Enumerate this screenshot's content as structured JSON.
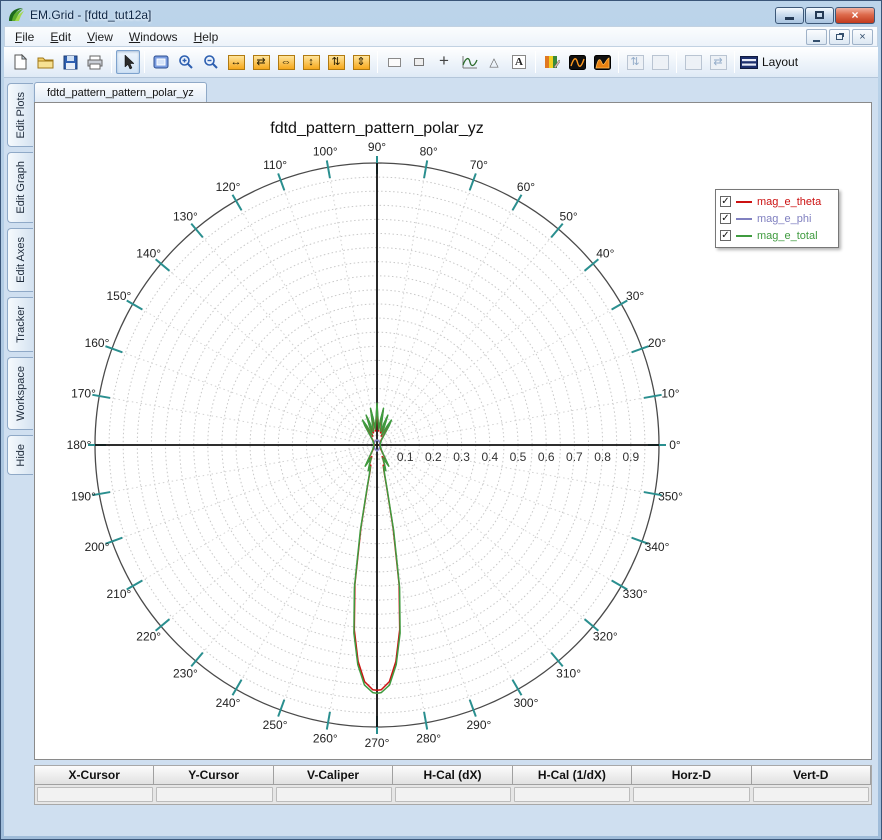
{
  "window": {
    "title": "EM.Grid - [fdtd_tut12a]"
  },
  "menu": {
    "items": [
      {
        "label": "File"
      },
      {
        "label": "Edit"
      },
      {
        "label": "View"
      },
      {
        "label": "Windows"
      },
      {
        "label": "Help"
      }
    ]
  },
  "toolbar": {
    "groups": [
      {
        "items": [
          {
            "icon": "new-document"
          },
          {
            "icon": "open-folder"
          },
          {
            "icon": "save"
          },
          {
            "icon": "print"
          }
        ]
      },
      {
        "items": [
          {
            "icon": "select-cursor",
            "pressed": true
          }
        ]
      },
      {
        "items": [
          {
            "icon": "zoom-region"
          },
          {
            "icon": "zoom-in"
          },
          {
            "icon": "zoom-out"
          },
          {
            "icon": "expand-horizontal"
          },
          {
            "icon": "pan-horizontal"
          },
          {
            "icon": "shrink-horizontal"
          },
          {
            "icon": "expand-vertical"
          },
          {
            "icon": "pan-vertical"
          },
          {
            "icon": "shrink-vertical"
          }
        ]
      },
      {
        "items": [
          {
            "icon": "draw-rectangle"
          },
          {
            "icon": "draw-box"
          },
          {
            "icon": "crosshair"
          },
          {
            "icon": "trace-curve"
          },
          {
            "icon": "draw-triangle"
          },
          {
            "icon": "text-annotation"
          }
        ]
      },
      {
        "items": [
          {
            "icon": "colormap-edit"
          },
          {
            "icon": "waveform-dark"
          },
          {
            "icon": "waveform-filled"
          }
        ]
      },
      {
        "items": [
          {
            "icon": "fit-vertical",
            "disabled": true
          },
          {
            "icon": "blank-tile",
            "disabled": true
          }
        ]
      },
      {
        "items": [
          {
            "icon": "blank-tile-2",
            "disabled": true
          },
          {
            "icon": "fit-horizontal",
            "disabled": true
          }
        ]
      },
      {
        "items": [
          {
            "icon": "layout-panels",
            "label": "Layout"
          }
        ]
      }
    ]
  },
  "sidebar": {
    "tabs": [
      "Edit Plots",
      "Edit Graph",
      "Edit Axes",
      "Tracker",
      "Workspace",
      "Hide"
    ]
  },
  "document_tab": "fdtd_pattern_pattern_polar_yz",
  "legend": {
    "items": [
      {
        "label": "mag_e_theta",
        "color": "#cc1111",
        "checked": true
      },
      {
        "label": "mag_e_phi",
        "color": "#8080c0",
        "checked": true
      },
      {
        "label": "mag_e_total",
        "color": "#3f9b3f",
        "checked": true
      }
    ]
  },
  "chart_data": {
    "type": "line",
    "subtype": "polar",
    "title": "fdtd_pattern_pattern_polar_yz",
    "angle_ticks_deg": [
      0,
      10,
      20,
      30,
      40,
      50,
      60,
      70,
      80,
      90,
      100,
      110,
      120,
      130,
      140,
      150,
      160,
      170,
      180,
      190,
      200,
      210,
      220,
      230,
      240,
      250,
      260,
      270,
      280,
      290,
      300,
      310,
      320,
      330,
      340,
      350
    ],
    "angle_tick_suffix": "°",
    "radius_ticks": [
      0.1,
      0.2,
      0.3,
      0.4,
      0.5,
      0.6,
      0.7,
      0.8,
      0.9
    ],
    "rlim": [
      0,
      1
    ],
    "rings": 20,
    "spoke_step_deg": 10,
    "grid": true,
    "legend_position": "top-right",
    "series": [
      {
        "name": "mag_e_theta",
        "color": "#cc1111",
        "points": [
          [
            0,
            0.01
          ],
          [
            15,
            0.01
          ],
          [
            30,
            0.012
          ],
          [
            40,
            0.015
          ],
          [
            48,
            0.02
          ],
          [
            54,
            0.035
          ],
          [
            58,
            0.075
          ],
          [
            60,
            0.095
          ],
          [
            62,
            0.07
          ],
          [
            64,
            0.035
          ],
          [
            67,
            0.05
          ],
          [
            70,
            0.105
          ],
          [
            72,
            0.075
          ],
          [
            74,
            0.045
          ],
          [
            77,
            0.06
          ],
          [
            80,
            0.125
          ],
          [
            82,
            0.085
          ],
          [
            84,
            0.05
          ],
          [
            87,
            0.075
          ],
          [
            90,
            0.14
          ],
          [
            93,
            0.075
          ],
          [
            96,
            0.05
          ],
          [
            98,
            0.085
          ],
          [
            100,
            0.125
          ],
          [
            103,
            0.06
          ],
          [
            106,
            0.045
          ],
          [
            108,
            0.075
          ],
          [
            110,
            0.105
          ],
          [
            113,
            0.05
          ],
          [
            116,
            0.035
          ],
          [
            118,
            0.07
          ],
          [
            120,
            0.095
          ],
          [
            122,
            0.075
          ],
          [
            126,
            0.035
          ],
          [
            132,
            0.02
          ],
          [
            140,
            0.015
          ],
          [
            150,
            0.012
          ],
          [
            165,
            0.01
          ],
          [
            180,
            0.01
          ],
          [
            195,
            0.01
          ],
          [
            210,
            0.012
          ],
          [
            220,
            0.015
          ],
          [
            228,
            0.02
          ],
          [
            234,
            0.03
          ],
          [
            238,
            0.05
          ],
          [
            241,
            0.08
          ],
          [
            243,
            0.06
          ],
          [
            246,
            0.045
          ],
          [
            249,
            0.07
          ],
          [
            251,
            0.09
          ],
          [
            253,
            0.075
          ],
          [
            255,
            0.095
          ],
          [
            257,
            0.15
          ],
          [
            259,
            0.3
          ],
          [
            261,
            0.5
          ],
          [
            263,
            0.66
          ],
          [
            265,
            0.77
          ],
          [
            267,
            0.84
          ],
          [
            269,
            0.868
          ],
          [
            270,
            0.87
          ],
          [
            271,
            0.868
          ],
          [
            273,
            0.84
          ],
          [
            275,
            0.77
          ],
          [
            277,
            0.66
          ],
          [
            279,
            0.5
          ],
          [
            281,
            0.3
          ],
          [
            283,
            0.15
          ],
          [
            285,
            0.095
          ],
          [
            287,
            0.075
          ],
          [
            289,
            0.09
          ],
          [
            291,
            0.07
          ],
          [
            294,
            0.045
          ],
          [
            297,
            0.06
          ],
          [
            299,
            0.08
          ],
          [
            302,
            0.05
          ],
          [
            306,
            0.03
          ],
          [
            312,
            0.02
          ],
          [
            320,
            0.015
          ],
          [
            330,
            0.012
          ],
          [
            345,
            0.01
          ],
          [
            360,
            0.01
          ]
        ]
      },
      {
        "name": "mag_e_phi",
        "color": "#8080c0",
        "points": [
          [
            0,
            0.012
          ],
          [
            30,
            0.012
          ],
          [
            60,
            0.015
          ],
          [
            90,
            0.018
          ],
          [
            120,
            0.015
          ],
          [
            150,
            0.012
          ],
          [
            180,
            0.012
          ],
          [
            210,
            0.012
          ],
          [
            240,
            0.015
          ],
          [
            270,
            0.022
          ],
          [
            300,
            0.015
          ],
          [
            330,
            0.012
          ],
          [
            360,
            0.012
          ]
        ]
      },
      {
        "name": "mag_e_total",
        "color": "#3f9b3f",
        "points": [
          [
            0,
            0.012
          ],
          [
            15,
            0.012
          ],
          [
            30,
            0.014
          ],
          [
            40,
            0.018
          ],
          [
            48,
            0.024
          ],
          [
            54,
            0.04
          ],
          [
            58,
            0.082
          ],
          [
            60,
            0.102
          ],
          [
            62,
            0.076
          ],
          [
            64,
            0.04
          ],
          [
            67,
            0.056
          ],
          [
            70,
            0.112
          ],
          [
            72,
            0.082
          ],
          [
            74,
            0.05
          ],
          [
            77,
            0.066
          ],
          [
            80,
            0.132
          ],
          [
            82,
            0.092
          ],
          [
            84,
            0.056
          ],
          [
            87,
            0.082
          ],
          [
            90,
            0.148
          ],
          [
            93,
            0.082
          ],
          [
            96,
            0.056
          ],
          [
            98,
            0.092
          ],
          [
            100,
            0.132
          ],
          [
            103,
            0.066
          ],
          [
            106,
            0.05
          ],
          [
            108,
            0.082
          ],
          [
            110,
            0.112
          ],
          [
            113,
            0.056
          ],
          [
            116,
            0.04
          ],
          [
            118,
            0.076
          ],
          [
            120,
            0.102
          ],
          [
            122,
            0.082
          ],
          [
            126,
            0.04
          ],
          [
            132,
            0.024
          ],
          [
            140,
            0.018
          ],
          [
            150,
            0.014
          ],
          [
            165,
            0.012
          ],
          [
            180,
            0.012
          ],
          [
            195,
            0.012
          ],
          [
            210,
            0.014
          ],
          [
            220,
            0.018
          ],
          [
            228,
            0.024
          ],
          [
            234,
            0.034
          ],
          [
            238,
            0.055
          ],
          [
            241,
            0.086
          ],
          [
            243,
            0.066
          ],
          [
            246,
            0.05
          ],
          [
            249,
            0.076
          ],
          [
            251,
            0.096
          ],
          [
            253,
            0.08
          ],
          [
            255,
            0.1
          ],
          [
            257,
            0.158
          ],
          [
            259,
            0.31
          ],
          [
            261,
            0.512
          ],
          [
            263,
            0.672
          ],
          [
            265,
            0.782
          ],
          [
            267,
            0.852
          ],
          [
            269,
            0.878
          ],
          [
            270,
            0.88
          ],
          [
            271,
            0.878
          ],
          [
            273,
            0.852
          ],
          [
            275,
            0.782
          ],
          [
            277,
            0.672
          ],
          [
            279,
            0.512
          ],
          [
            281,
            0.31
          ],
          [
            283,
            0.158
          ],
          [
            285,
            0.1
          ],
          [
            287,
            0.08
          ],
          [
            289,
            0.096
          ],
          [
            291,
            0.076
          ],
          [
            294,
            0.05
          ],
          [
            297,
            0.066
          ],
          [
            299,
            0.086
          ],
          [
            302,
            0.055
          ],
          [
            306,
            0.034
          ],
          [
            312,
            0.024
          ],
          [
            320,
            0.018
          ],
          [
            330,
            0.014
          ],
          [
            345,
            0.012
          ],
          [
            360,
            0.012
          ]
        ]
      }
    ]
  },
  "cursor_table": {
    "headers": [
      "X-Cursor",
      "Y-Cursor",
      "V-Caliper",
      "H-Cal (dX)",
      "H-Cal (1/dX)",
      "Horz-D",
      "Vert-D"
    ],
    "values": [
      "",
      "",
      "",
      "",
      "",
      "",
      ""
    ]
  }
}
